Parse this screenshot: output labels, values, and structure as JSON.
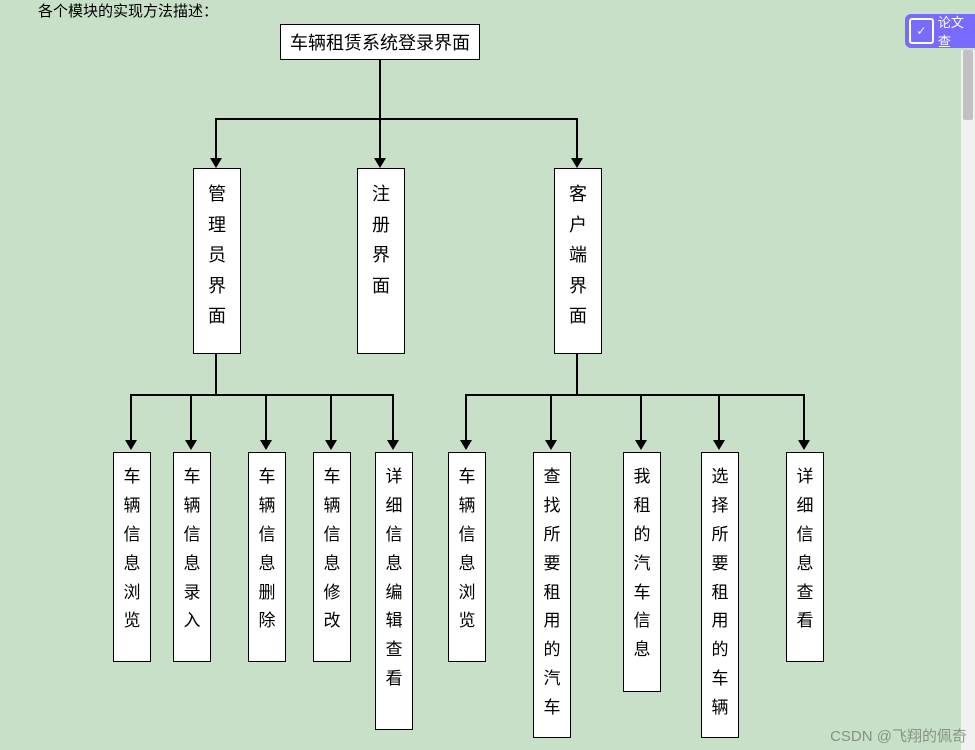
{
  "root": {
    "label": "车辆租赁系统登录界面"
  },
  "level2": {
    "admin": "管理员界面",
    "register": "注册界面",
    "client": "客户端界面"
  },
  "admin_leaves": [
    "车辆信息浏览",
    "车辆信息录入",
    "车辆信息删除",
    "车辆信息修改",
    "详细信息编辑查看"
  ],
  "client_leaves": [
    "车辆信息浏览",
    "查找所要租用的汽车",
    "我租的汽车信息",
    "选择所要租用的车辆",
    "详细信息查看"
  ],
  "badge": {
    "label": "论文查"
  },
  "watermark": "CSDN @飞翔的佩奇",
  "top_fragment": "各个模块的实现方法描述："
}
